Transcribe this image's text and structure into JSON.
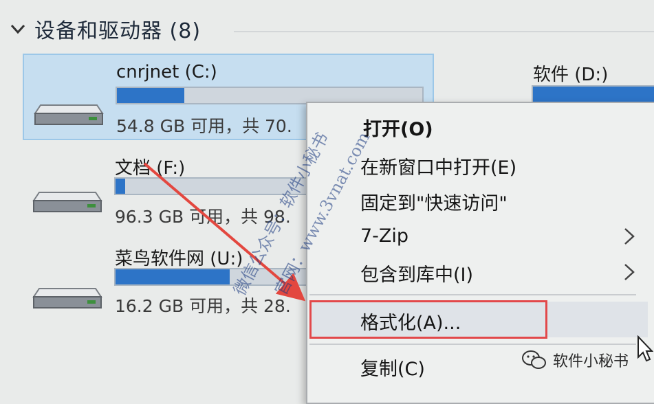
{
  "section": {
    "title": "设备和驱动器 (8)"
  },
  "drives": [
    {
      "name": "cnrjnet (C:)",
      "free_text": "54.8 GB 可用，共 70.",
      "used_fraction": 0.28,
      "selected": true
    },
    {
      "name": "软件 (D:)",
      "free_text": "",
      "used_fraction": 0.6,
      "selected": false
    },
    {
      "name": "文档 (F:)",
      "free_text": "96.3 GB 可用，共 98.",
      "used_fraction": 0.03,
      "selected": false
    },
    {
      "name": "菜鸟软件网 (U:)",
      "free_text": "16.2 GB 可用，共 28.",
      "used_fraction": 0.42,
      "selected": false
    }
  ],
  "context_menu": {
    "items": [
      {
        "label": "打开(O)",
        "bold": true
      },
      {
        "label": "在新窗口中打开(E)"
      },
      {
        "label": "固定到\"快速访问\""
      },
      {
        "label": "7-Zip",
        "submenu": true
      },
      {
        "label": "包含到库中(I)",
        "submenu": true
      },
      {
        "label": "格式化(A)...",
        "highlighted": true
      },
      {
        "label": "复制(C)"
      }
    ]
  },
  "watermarks": {
    "line1": "微信公众号：软件小秘书",
    "line2": "官网：www.3vnat.com"
  },
  "badge": {
    "label": "软件小秘书"
  },
  "colors": {
    "selection": "#c6def0",
    "bar_fill": "#2d74c7",
    "highlight_box": "#e2484a",
    "annotation_arrow": "#e3473f"
  }
}
